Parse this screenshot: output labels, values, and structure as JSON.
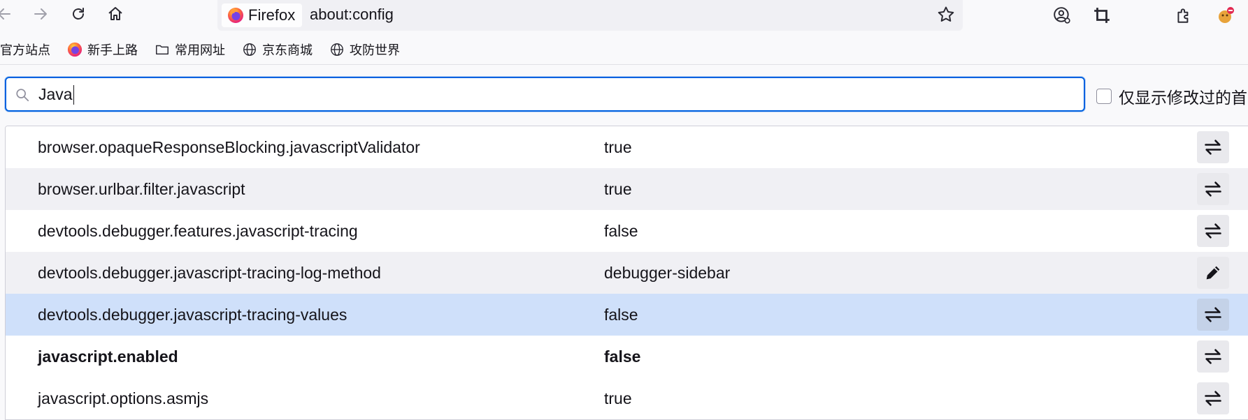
{
  "toolbar": {
    "back_icon": "arrow-left-icon",
    "forward_icon": "arrow-right-icon",
    "reload_icon": "reload-icon",
    "home_icon": "home-icon",
    "identity_label": "Firefox",
    "url": "about:config",
    "right_icons": [
      "account-icon",
      "crop-icon",
      "extensions-icon",
      "avatar-icon"
    ]
  },
  "bookmarks": {
    "items": [
      {
        "label": "官方站点",
        "icon": "none"
      },
      {
        "label": "新手上路",
        "icon": "firefox-icon"
      },
      {
        "label": "常用网址",
        "icon": "folder-icon"
      },
      {
        "label": "京东商城",
        "icon": "globe-icon"
      },
      {
        "label": "攻防世界",
        "icon": "globe-icon"
      }
    ]
  },
  "search": {
    "value": "Java",
    "placeholder": ""
  },
  "modified_toggle": {
    "label": "仅显示修改过的首选项",
    "checked": false
  },
  "prefs": [
    {
      "name": "browser.opaqueResponseBlocking.javascriptValidator",
      "value": "true",
      "action": "toggle-icon",
      "bold": false
    },
    {
      "name": "browser.urlbar.filter.javascript",
      "value": "true",
      "action": "toggle-icon",
      "bold": false
    },
    {
      "name": "devtools.debugger.features.javascript-tracing",
      "value": "false",
      "action": "toggle-icon",
      "bold": false
    },
    {
      "name": "devtools.debugger.javascript-tracing-log-method",
      "value": "debugger-sidebar",
      "action": "edit-icon",
      "bold": false
    },
    {
      "name": "devtools.debugger.javascript-tracing-values",
      "value": "false",
      "action": "toggle-icon",
      "bold": false,
      "selected": true
    },
    {
      "name": "javascript.enabled",
      "value": "false",
      "action": "toggle-icon",
      "bold": true
    },
    {
      "name": "javascript.options.asmjs",
      "value": "true",
      "action": "toggle-icon",
      "bold": false
    }
  ],
  "colors": {
    "accent": "#0061e0",
    "selected_row": "#cfe0fa",
    "odd_row": "#f0f0f4"
  }
}
